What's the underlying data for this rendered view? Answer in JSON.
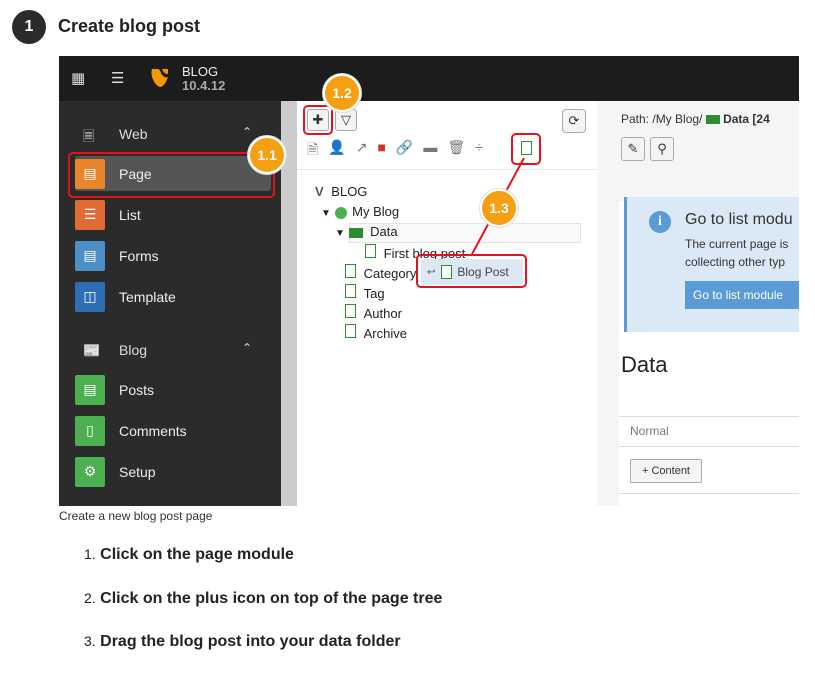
{
  "step": {
    "number": "1",
    "title": "Create blog post"
  },
  "topbar": {
    "brand": "BLOG",
    "version": "10.4.12"
  },
  "sidebar": {
    "groups": [
      {
        "label": "Web"
      },
      {
        "label": "Blog"
      }
    ],
    "items": [
      {
        "label": "Page",
        "color": "#e8852b"
      },
      {
        "label": "List",
        "color": "#e06b34"
      },
      {
        "label": "Forms",
        "color": "#4c8fc7"
      },
      {
        "label": "Template",
        "color": "#2e6eb5"
      },
      {
        "label": "Posts",
        "color": "#4caf50"
      },
      {
        "label": "Comments",
        "color": "#4caf50"
      },
      {
        "label": "Setup",
        "color": "#4caf50"
      }
    ]
  },
  "tree": {
    "root": "BLOG",
    "site": "My Blog",
    "folder": "Data",
    "child": "First blog post",
    "pages": [
      "Category",
      "Tag",
      "Author",
      "Archive"
    ],
    "drag_label": "Blog Post"
  },
  "callouts": [
    "1.1",
    "1.2",
    "1.3"
  ],
  "right": {
    "path_label": "Path: /My Blog/",
    "path_current": "Data [24",
    "info_title": "Go to list modu",
    "info_line1": "The current page is",
    "info_line2": "collecting other typ",
    "info_button": "Go to list module",
    "heading": "Data",
    "column": "Normal",
    "content_button": "+ Content"
  },
  "caption": "Create a new blog post page",
  "instructions": [
    {
      "num": "1.",
      "text": "Click on the page module"
    },
    {
      "num": "2.",
      "text": "Click on the plus icon on top of the page tree"
    },
    {
      "num": "3.",
      "text": "Drag the blog post into your data folder"
    }
  ],
  "colors": {
    "accent": "#f5a012",
    "highlight": "#e0141e",
    "typo3": "#f49700"
  }
}
